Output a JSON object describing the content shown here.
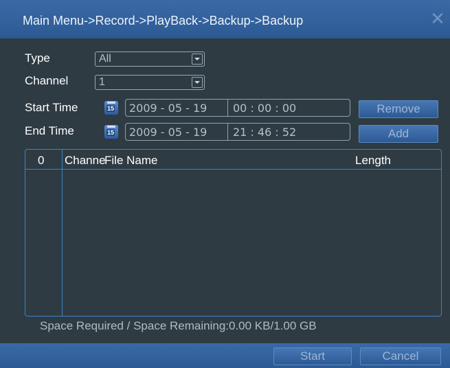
{
  "title": "Main Menu->Record->PlayBack->Backup->Backup",
  "close_glyph": "✕",
  "form": {
    "type_label": "Type",
    "type_value": "All",
    "channel_label": "Channel",
    "channel_value": "1",
    "start_label": "Start Time",
    "start_date": "2009  - 05 - 19",
    "start_time": "00 : 00 : 00",
    "end_label": "End Time",
    "end_date": "2009  - 05 - 19",
    "end_time": "21 : 46 : 52",
    "calendar_icon_text": "15"
  },
  "buttons": {
    "remove": "Remove",
    "add": "Add",
    "start": "Start",
    "cancel": "Cancel"
  },
  "table": {
    "columns": [
      "0",
      "Channe",
      "File Name",
      "Length"
    ],
    "rows": []
  },
  "status": "Space Required / Space Remaining:0.00 KB/1.00 GB",
  "colors": {
    "background": "#2e3b43",
    "title_bar": "#2f5e98",
    "table_border": "#3d83c9",
    "button": "#3a6aa6"
  }
}
